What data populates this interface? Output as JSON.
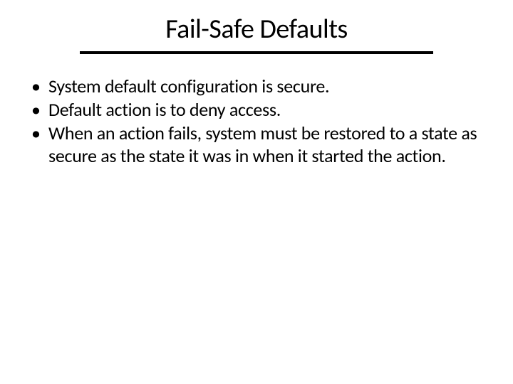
{
  "slide": {
    "title": "Fail-Safe Defaults",
    "bullets": [
      "System default configuration is secure.",
      "Default action is to deny access.",
      "When an action fails, system must be restored to a state as secure as the state it was in when it started the action."
    ]
  }
}
